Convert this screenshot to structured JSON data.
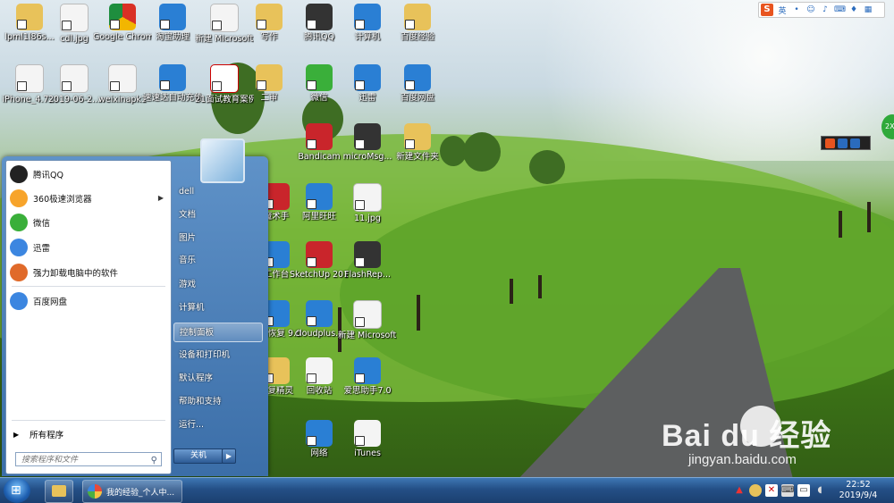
{
  "desktop": {
    "icons": [
      {
        "label": "lpml1l86s...",
        "kind": "folder",
        "color": "#e8c25a"
      },
      {
        "label": "cdl.jpg",
        "kind": "file",
        "color": "#f4f4f4"
      },
      {
        "label": "Google Chrome",
        "kind": "chrome",
        "color": "#d93025"
      },
      {
        "label": "淘宝助理",
        "kind": "app",
        "color": "#2a7fd4"
      },
      {
        "label": "新建 Microsoft...",
        "kind": "file",
        "color": "#f4f4f4"
      },
      {
        "label": "写作",
        "kind": "folder",
        "color": "#e8c25a"
      },
      {
        "label": "腾讯QQ",
        "kind": "app",
        "color": "#333333"
      },
      {
        "label": "计算机",
        "kind": "app",
        "color": "#2a7fd4"
      },
      {
        "label": "百度经验",
        "kind": "folder",
        "color": "#e8c25a"
      },
      {
        "label": "iPhone_4.7...",
        "kind": "file",
        "color": "#f4f4f4"
      },
      {
        "label": "2019-06-2...",
        "kind": "file",
        "color": "#f4f4f4"
      },
      {
        "label": "weixinapk1",
        "kind": "file",
        "color": "#f4f4f4"
      },
      {
        "label": "速速达自动充值2018...",
        "kind": "app",
        "color": "#2a7fd4"
      },
      {
        "label": "21面试教育案例题解析一...",
        "kind": "pdf",
        "color": "#c9252b"
      },
      {
        "label": "二审",
        "kind": "folder",
        "color": "#e8c25a"
      },
      {
        "label": "微信",
        "kind": "app",
        "color": "#3aaf3a"
      },
      {
        "label": "迅雷",
        "kind": "app",
        "color": "#2a7fd4"
      },
      {
        "label": "百度网盘",
        "kind": "app",
        "color": "#2a7fd4"
      },
      {
        "label": "Bandicam",
        "kind": "app",
        "color": "#c9252b"
      },
      {
        "label": "microMsg...",
        "kind": "app",
        "color": "#333333"
      },
      {
        "label": "新建文件夹",
        "kind": "folder",
        "color": "#e8c25a"
      },
      {
        "label": "魔术手",
        "kind": "app",
        "color": "#c9252b"
      },
      {
        "label": "阿里旺旺",
        "kind": "app",
        "color": "#2a7fd4"
      },
      {
        "label": "11.jpg",
        "kind": "file",
        "color": "#f4f4f4"
      },
      {
        "label": "工作台",
        "kind": "app",
        "color": "#2a7fd4"
      },
      {
        "label": "SketchUp 2014",
        "kind": "app",
        "color": "#c9252b"
      },
      {
        "label": "FlashRep...",
        "kind": "app",
        "color": "#333333"
      },
      {
        "label": "数据恢复 9.0",
        "kind": "app",
        "color": "#2a7fd4"
      },
      {
        "label": "cloudplus...",
        "kind": "app",
        "color": "#2a7fd4"
      },
      {
        "label": "新建 Microsoft...",
        "kind": "file",
        "color": "#f4f4f4"
      },
      {
        "label": "恢复精灵",
        "kind": "app",
        "color": "#e8c25a"
      },
      {
        "label": "回收站",
        "kind": "app",
        "color": "#f4f4f4"
      },
      {
        "label": "爱思助手7.0",
        "kind": "app",
        "color": "#2a7fd4"
      },
      {
        "label": "网络",
        "kind": "app",
        "color": "#2a7fd4"
      },
      {
        "label": "iTunes",
        "kind": "app",
        "color": "#f4f4f4"
      }
    ]
  },
  "start_menu": {
    "pinned": [
      {
        "label": "腾讯QQ",
        "icon": "qq-icon",
        "color": "#222222",
        "has_arrow": false
      },
      {
        "label": "360极速浏览器",
        "icon": "browser-360-icon",
        "color": "#f7a42b",
        "has_arrow": true
      },
      {
        "label": "微信",
        "icon": "wechat-icon",
        "color": "#3aaf3a",
        "has_arrow": false
      },
      {
        "label": "迅雷",
        "icon": "thunder-icon",
        "color": "#3c86e0",
        "has_arrow": false
      },
      {
        "label": "强力卸载电脑中的软件",
        "icon": "uninstall-icon",
        "color": "#e06a2a",
        "has_arrow": false
      },
      {
        "label": "百度网盘",
        "icon": "baidu-netdisk-icon",
        "color": "#3c86e0",
        "has_arrow": false
      }
    ],
    "all_programs": "所有程序",
    "search_placeholder": "搜索程序和文件",
    "right_items": [
      {
        "label": "dell",
        "highlight": false
      },
      {
        "label": "文档",
        "highlight": false
      },
      {
        "label": "图片",
        "highlight": false
      },
      {
        "label": "音乐",
        "highlight": false
      },
      {
        "label": "游戏",
        "highlight": false
      },
      {
        "label": "计算机",
        "highlight": false
      },
      {
        "label": "控制面板",
        "highlight": true
      },
      {
        "label": "设备和打印机",
        "highlight": false
      },
      {
        "label": "默认程序",
        "highlight": false
      },
      {
        "label": "帮助和支持",
        "highlight": false
      },
      {
        "label": "运行...",
        "highlight": false
      }
    ],
    "shutdown_label": "关机"
  },
  "taskbar": {
    "browser_button_label": "我的经验_个人中...",
    "clock_time": "22:52",
    "clock_date": "2019/9/4"
  },
  "sogou": {
    "logo": "S",
    "mode": "英"
  },
  "watermark": {
    "logo": "Bai du 经验",
    "url": "jingyan.baidu.com"
  },
  "colors": {
    "taskbar": "#244f86",
    "start_menu": "#3b6ea8",
    "highlight": "#ffffff"
  }
}
